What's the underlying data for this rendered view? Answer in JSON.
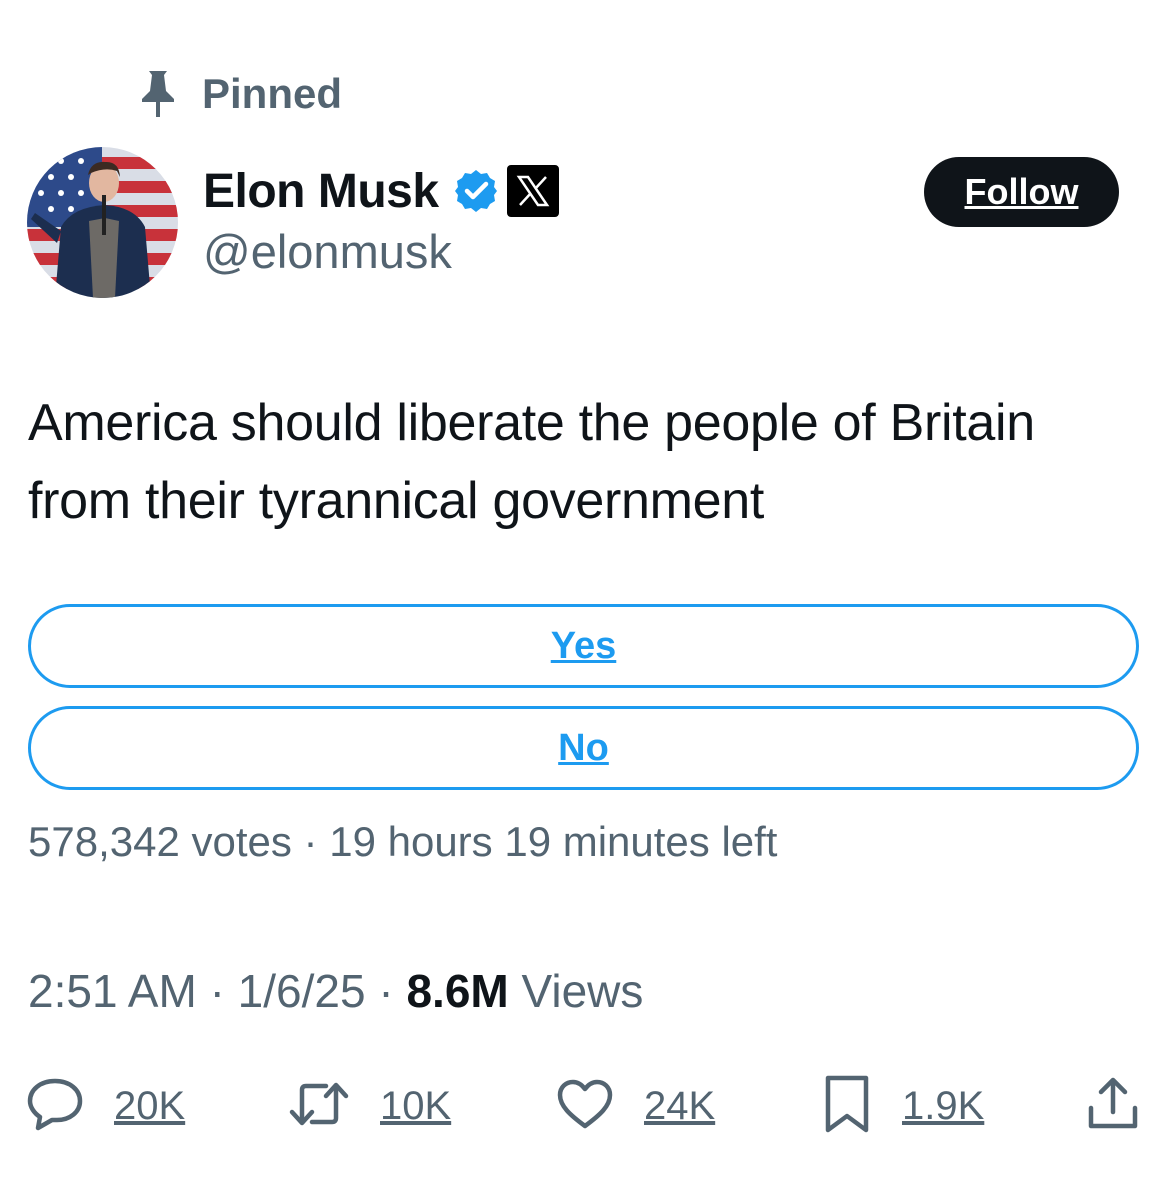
{
  "pinned": {
    "label": "Pinned",
    "icon": "pin-icon"
  },
  "author": {
    "name": "Elon Musk",
    "handle": "@elonmusk",
    "verified_icon": "verified-badge-icon",
    "affiliate_icon": "x-logo-icon",
    "avatar": "avatar"
  },
  "follow_label": "Follow",
  "tweet": {
    "text": "America should liberate the people of Britain from their tyrannical government"
  },
  "poll": {
    "options": [
      {
        "label": "Yes"
      },
      {
        "label": "No"
      }
    ],
    "votes": "578,342 votes",
    "separator": "·",
    "time_left": "19 hours 19 minutes left"
  },
  "meta": {
    "time": "2:51 AM",
    "date": "1/6/25",
    "separator": "·",
    "views_count": "8.6M",
    "views_label": "Views"
  },
  "actions": {
    "replies": "20K",
    "reposts": "10K",
    "likes": "24K",
    "bookmarks": "1.9K"
  },
  "colors": {
    "accent": "#1d9bf0",
    "text": "#0f1419",
    "secondary": "#536471",
    "follow_bg": "#0f1419"
  }
}
